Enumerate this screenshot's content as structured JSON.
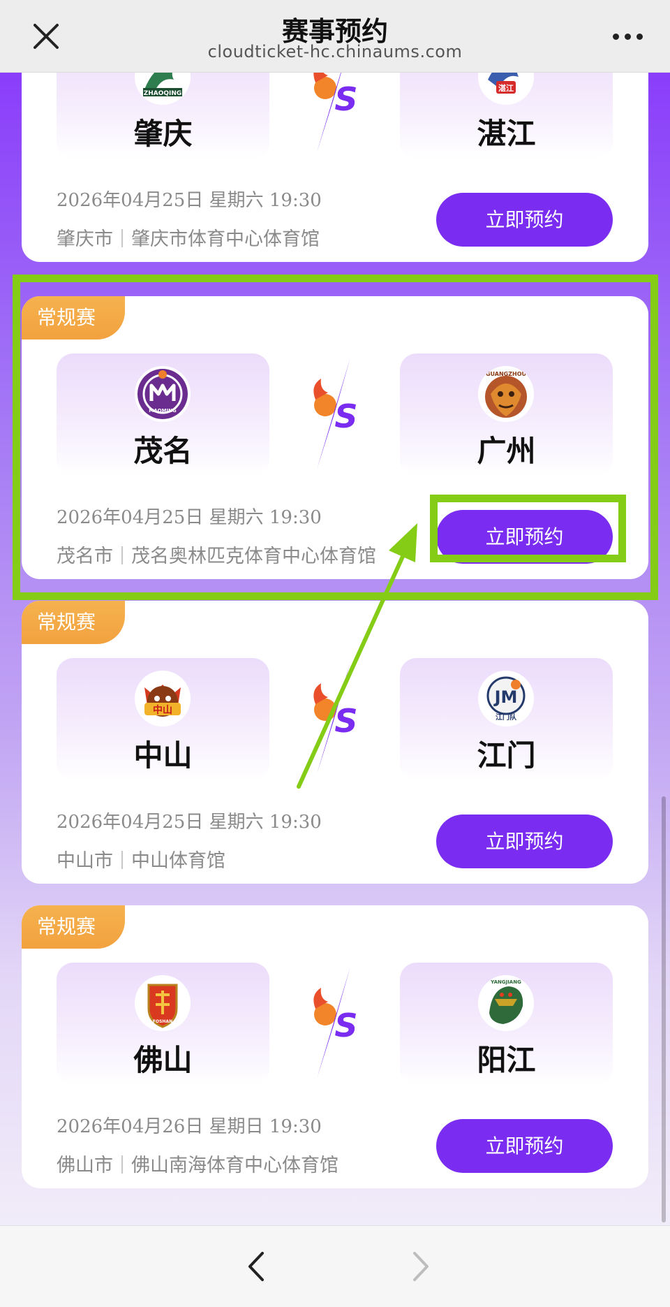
{
  "header": {
    "title": "赛事预约",
    "url": "cloudticket-hc.chinaums.com"
  },
  "matches": [
    {
      "badge": "",
      "home": {
        "name": "肇庆",
        "logo_text": "ZHAOQING"
      },
      "away": {
        "name": "湛江",
        "logo_text": "湛江"
      },
      "date": "2026年04月25日 星期六 19:30",
      "city": "肇庆市",
      "venue": "肇庆市体育中心体育馆",
      "button": "立即预约"
    },
    {
      "badge": "常规赛",
      "home": {
        "name": "茂名",
        "logo_text": "MAOMING"
      },
      "away": {
        "name": "广州",
        "logo_text": "GUANGZHOU"
      },
      "date": "2026年04月25日 星期六 19:30",
      "city": "茂名市",
      "venue": "茂名奥林匹克体育中心体育馆",
      "button": "立即预约"
    },
    {
      "badge": "常规赛",
      "home": {
        "name": "中山",
        "logo_text": "中山"
      },
      "away": {
        "name": "江门",
        "logo_text": "江门队"
      },
      "date": "2026年04月25日 星期六 19:30",
      "city": "中山市",
      "venue": "中山体育馆",
      "button": "立即预约"
    },
    {
      "badge": "常规赛",
      "home": {
        "name": "佛山",
        "logo_text": "FOSHAN"
      },
      "away": {
        "name": "阳江",
        "logo_text": "YANGJIANG"
      },
      "date": "2026年04月26日 星期日 19:30",
      "city": "佛山市",
      "venue": "佛山南海体育中心体育馆",
      "button": "立即预约"
    }
  ],
  "icons": {
    "close": "close-icon",
    "more": "more-icon",
    "back": "chevron-left-icon",
    "forward": "chevron-right-icon",
    "vs": "vs-icon"
  },
  "colors": {
    "primary": "#7a2df0",
    "badge": "#f2a23f",
    "highlight": "#84cc16"
  }
}
